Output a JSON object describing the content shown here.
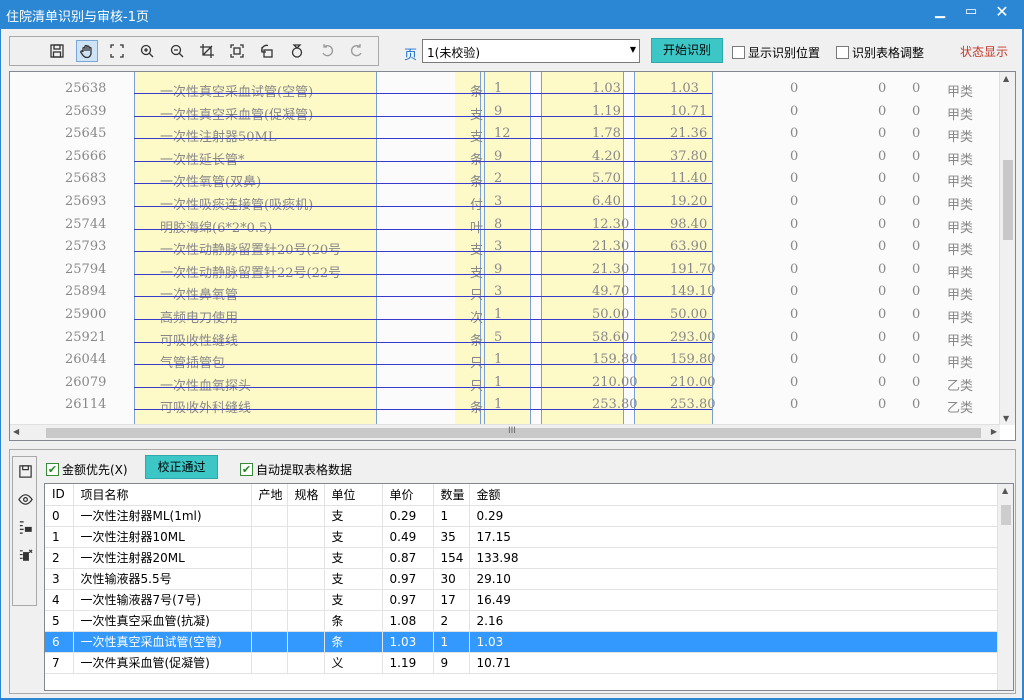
{
  "window": {
    "title": "住院清单识别与审核-1页",
    "min": "▁",
    "max": "▭",
    "close": "✕"
  },
  "toolbar": {
    "icons": [
      "save-icon",
      "hand-icon",
      "select-icon",
      "zoom-in-icon",
      "zoom-out-icon",
      "crop-icon",
      "fit-icon",
      "rotate-left-icon",
      "rotate-right-icon",
      "undo-icon",
      "redo-icon"
    ],
    "page_label": "页",
    "page_value": "1(未校验)",
    "start_button": "开始识别",
    "show_position": "显示识别位置",
    "table_adjust": "识别表格调整",
    "state_show": "状态显示"
  },
  "scan": {
    "rows": [
      {
        "code": "25638",
        "name": "一次性真空采血试管(空管)",
        "unit": "条",
        "qty": "1",
        "price": "1.03",
        "amount": "1.03",
        "z1": "0",
        "z2": "0",
        "z3": "0",
        "cls": "甲类"
      },
      {
        "code": "25639",
        "name": "一次性真空采血管(促凝管)",
        "unit": "支",
        "qty": "9",
        "price": "1.19",
        "amount": "10.71",
        "z1": "0",
        "z2": "0",
        "z3": "0",
        "cls": "甲类"
      },
      {
        "code": "25645",
        "name": "一次性注射器50ML",
        "unit": "支",
        "qty": "12",
        "price": "1.78",
        "amount": "21.36",
        "z1": "0",
        "z2": "0",
        "z3": "0",
        "cls": "甲类"
      },
      {
        "code": "25666",
        "name": "一次性延长管*",
        "unit": "条",
        "qty": "9",
        "price": "4.20",
        "amount": "37.80",
        "z1": "0",
        "z2": "0",
        "z3": "0",
        "cls": "甲类"
      },
      {
        "code": "25683",
        "name": "一次性氧管(双鼻)",
        "unit": "条",
        "qty": "2",
        "price": "5.70",
        "amount": "11.40",
        "z1": "0",
        "z2": "0",
        "z3": "0",
        "cls": "甲类"
      },
      {
        "code": "25693",
        "name": "一次性吸痰连接管(吸痰机)",
        "unit": "付",
        "qty": "3",
        "price": "6.40",
        "amount": "19.20",
        "z1": "0",
        "z2": "0",
        "z3": "0",
        "cls": "甲类"
      },
      {
        "code": "25744",
        "name": "明胶海绵(6*2*0.5)",
        "unit": "叶",
        "qty": "8",
        "price": "12.30",
        "amount": "98.40",
        "z1": "0",
        "z2": "0",
        "z3": "0",
        "cls": "甲类"
      },
      {
        "code": "25793",
        "name": "一次性动静脉留置针20号(20号",
        "unit": "支",
        "qty": "3",
        "price": "21.30",
        "amount": "63.90",
        "z1": "0",
        "z2": "0",
        "z3": "0",
        "cls": "甲类"
      },
      {
        "code": "25794",
        "name": "一次性动静脉留置针22号(22号",
        "unit": "支",
        "qty": "9",
        "price": "21.30",
        "amount": "191.70",
        "z1": "0",
        "z2": "0",
        "z3": "0",
        "cls": "甲类"
      },
      {
        "code": "25894",
        "name": "一次性鼻氧管",
        "unit": "只",
        "qty": "3",
        "price": "49.70",
        "amount": "149.10",
        "z1": "0",
        "z2": "0",
        "z3": "0",
        "cls": "甲类"
      },
      {
        "code": "25900",
        "name": "高频电刀使用",
        "unit": "次",
        "qty": "1",
        "price": "50.00",
        "amount": "50.00",
        "z1": "0",
        "z2": "0",
        "z3": "0",
        "cls": "甲类"
      },
      {
        "code": "25921",
        "name": "可吸收性缝线",
        "unit": "条",
        "qty": "5",
        "price": "58.60",
        "amount": "293.00",
        "z1": "0",
        "z2": "0",
        "z3": "0",
        "cls": "甲类"
      },
      {
        "code": "26044",
        "name": "气管插管包",
        "unit": "只",
        "qty": "1",
        "price": "159.80",
        "amount": "159.80",
        "z1": "0",
        "z2": "0",
        "z3": "0",
        "cls": "甲类"
      },
      {
        "code": "26079",
        "name": "一次性血氧探头",
        "unit": "只",
        "qty": "1",
        "price": "210.00",
        "amount": "210.00",
        "z1": "0",
        "z2": "0",
        "z3": "0",
        "cls": "乙类"
      },
      {
        "code": "26114",
        "name": "可吸收外科缝线",
        "unit": "条",
        "qty": "1",
        "price": "253.80",
        "amount": "253.80",
        "z1": "0",
        "z2": "0",
        "z3": "0",
        "cls": "乙类"
      }
    ],
    "grip": "III"
  },
  "bottom": {
    "amount_priority": "金额优先(X)",
    "pass_button": "校正通过",
    "auto_extract": "自动提取表格数据",
    "side_icons": [
      "save-icon",
      "eye-icon",
      "split-icon",
      "export-icon"
    ]
  },
  "grid": {
    "headers": [
      "ID",
      "项目名称",
      "产地",
      "规格",
      "单位",
      "单价",
      "数量",
      "金额"
    ],
    "rows": [
      [
        "0",
        "一次性注射器ML(1ml)",
        "",
        "",
        "支",
        "0.29",
        "1",
        "0.29"
      ],
      [
        "1",
        "一次性注射器10ML",
        "",
        "",
        "支",
        "0.49",
        "35",
        "17.15"
      ],
      [
        "2",
        "一次性注射器20ML",
        "",
        "",
        "支",
        "0.87",
        "154",
        "133.98"
      ],
      [
        "3",
        "次性输液器5.5号",
        "",
        "",
        "支",
        "0.97",
        "30",
        "29.10"
      ],
      [
        "4",
        "一次性输液器7号(7号)",
        "",
        "",
        "支",
        "0.97",
        "17",
        "16.49"
      ],
      [
        "5",
        "一次性真空采血管(抗凝)",
        "",
        "",
        "条",
        "1.08",
        "2",
        "2.16"
      ],
      [
        "6",
        "一次性真空采血试管(空管)",
        "",
        "",
        "条",
        "1.03",
        "1",
        "1.03"
      ],
      [
        "7",
        "一次件真采血管(促凝管)",
        "",
        "",
        "义",
        "1.19",
        "9",
        "10.71"
      ]
    ],
    "selected_index": 6
  }
}
